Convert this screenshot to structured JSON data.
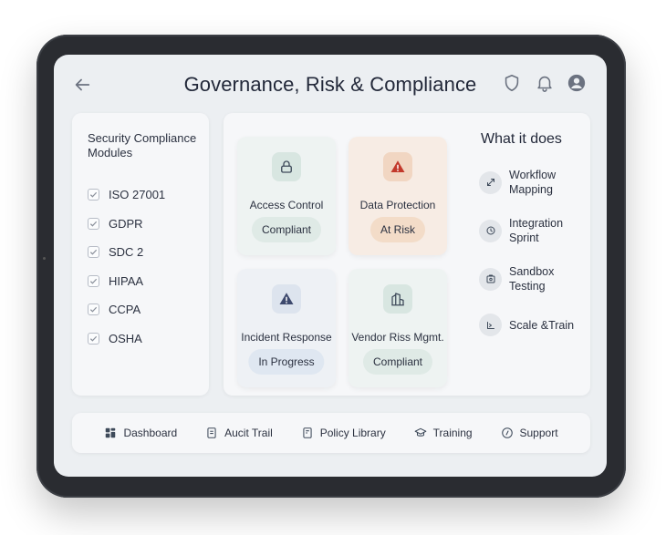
{
  "header": {
    "title": "Governance, Risk & Compliance",
    "icons": [
      "back-arrow-icon",
      "shield-icon",
      "bell-icon",
      "user-icon"
    ]
  },
  "modules": {
    "title": "Security Compliance Modules",
    "items": [
      {
        "label": "ISO 27001",
        "checked": true
      },
      {
        "label": "GDPR",
        "checked": true
      },
      {
        "label": "SDC 2",
        "checked": true
      },
      {
        "label": "HIPAA",
        "checked": true
      },
      {
        "label": "CCPA",
        "checked": true
      },
      {
        "label": "OSHA",
        "checked": true
      }
    ]
  },
  "cards": [
    {
      "title": "Access Control",
      "status": "Compliant",
      "icon": "lock-icon"
    },
    {
      "title": "Data Protection",
      "status": "At Risk",
      "icon": "warning-icon"
    },
    {
      "title": "Incident Response",
      "status": "In Progress",
      "icon": "alert-icon"
    },
    {
      "title": "Vendor Riss Mgmt.",
      "status": "Compliant",
      "icon": "building-icon"
    }
  ],
  "what_it_does": {
    "title": "What it does",
    "items": [
      {
        "label": "Workflow Mapping",
        "icon": "workflow-icon"
      },
      {
        "label": "Integration Sprint",
        "icon": "sprint-icon"
      },
      {
        "label": "Sandbox Testing",
        "icon": "sandbox-icon"
      },
      {
        "label": "Scale &Train",
        "icon": "scale-icon"
      }
    ]
  },
  "nav": [
    {
      "label": "Dashboard",
      "icon": "dashboard-icon"
    },
    {
      "label": "Aucit Trail",
      "icon": "document-icon"
    },
    {
      "label": "Policy Library",
      "icon": "policy-icon"
    },
    {
      "label": "Training",
      "icon": "graduation-cap-icon"
    },
    {
      "label": "Support",
      "icon": "support-icon"
    }
  ],
  "colors": {
    "compliant_bg": "#dfeae6",
    "at_risk_bg": "#f3dcc8",
    "in_progress_bg": "#dfe7f1",
    "warning_red": "#c2392b",
    "alert_navy": "#3e4a6e"
  }
}
